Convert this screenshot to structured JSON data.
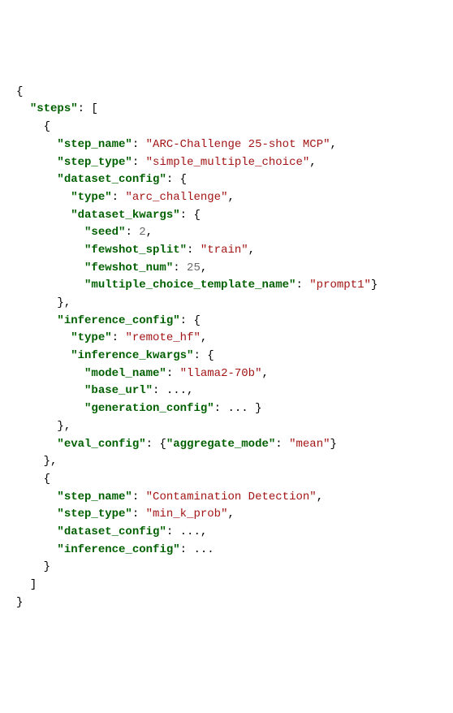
{
  "code": {
    "lines": [
      {
        "indent": 0,
        "tokens": [
          {
            "t": "p",
            "v": "{"
          }
        ]
      },
      {
        "indent": 1,
        "tokens": [
          {
            "t": "k",
            "v": "\"steps\""
          },
          {
            "t": "p",
            "v": ": ["
          }
        ]
      },
      {
        "indent": 2,
        "tokens": [
          {
            "t": "p",
            "v": "{"
          }
        ]
      },
      {
        "indent": 3,
        "tokens": [
          {
            "t": "k",
            "v": "\"step_name\""
          },
          {
            "t": "p",
            "v": ": "
          },
          {
            "t": "s",
            "v": "\"ARC-Challenge 25-shot MCP\""
          },
          {
            "t": "p",
            "v": ","
          }
        ]
      },
      {
        "indent": 3,
        "tokens": [
          {
            "t": "k",
            "v": "\"step_type\""
          },
          {
            "t": "p",
            "v": ": "
          },
          {
            "t": "s",
            "v": "\"simple_multiple_choice\""
          },
          {
            "t": "p",
            "v": ","
          }
        ]
      },
      {
        "indent": 3,
        "tokens": [
          {
            "t": "k",
            "v": "\"dataset_config\""
          },
          {
            "t": "p",
            "v": ": {"
          }
        ]
      },
      {
        "indent": 4,
        "tokens": [
          {
            "t": "k",
            "v": "\"type\""
          },
          {
            "t": "p",
            "v": ": "
          },
          {
            "t": "s",
            "v": "\"arc_challenge\""
          },
          {
            "t": "p",
            "v": ","
          }
        ]
      },
      {
        "indent": 4,
        "tokens": [
          {
            "t": "k",
            "v": "\"dataset_kwargs\""
          },
          {
            "t": "p",
            "v": ": {"
          }
        ]
      },
      {
        "indent": 5,
        "tokens": [
          {
            "t": "k",
            "v": "\"seed\""
          },
          {
            "t": "p",
            "v": ": "
          },
          {
            "t": "n",
            "v": "2"
          },
          {
            "t": "p",
            "v": ","
          }
        ]
      },
      {
        "indent": 5,
        "tokens": [
          {
            "t": "k",
            "v": "\"fewshot_split\""
          },
          {
            "t": "p",
            "v": ": "
          },
          {
            "t": "s",
            "v": "\"train\""
          },
          {
            "t": "p",
            "v": ","
          }
        ]
      },
      {
        "indent": 5,
        "tokens": [
          {
            "t": "k",
            "v": "\"fewshot_num\""
          },
          {
            "t": "p",
            "v": ": "
          },
          {
            "t": "n",
            "v": "25"
          },
          {
            "t": "p",
            "v": ","
          }
        ]
      },
      {
        "indent": 5,
        "tokens": [
          {
            "t": "k",
            "v": "\"multiple_choice_template_name\""
          },
          {
            "t": "p",
            "v": ": "
          },
          {
            "t": "s",
            "v": "\"prompt1\""
          },
          {
            "t": "p",
            "v": "}"
          }
        ]
      },
      {
        "indent": 3,
        "tokens": [
          {
            "t": "p",
            "v": "},"
          }
        ]
      },
      {
        "indent": 3,
        "tokens": [
          {
            "t": "k",
            "v": "\"inference_config\""
          },
          {
            "t": "p",
            "v": ": {"
          }
        ]
      },
      {
        "indent": 4,
        "tokens": [
          {
            "t": "k",
            "v": "\"type\""
          },
          {
            "t": "p",
            "v": ": "
          },
          {
            "t": "s",
            "v": "\"remote_hf\""
          },
          {
            "t": "p",
            "v": ","
          }
        ]
      },
      {
        "indent": 4,
        "tokens": [
          {
            "t": "k",
            "v": "\"inference_kwargs\""
          },
          {
            "t": "p",
            "v": ": {"
          }
        ]
      },
      {
        "indent": 5,
        "tokens": [
          {
            "t": "k",
            "v": "\"model_name\""
          },
          {
            "t": "p",
            "v": ": "
          },
          {
            "t": "s",
            "v": "\"llama2-70b\""
          },
          {
            "t": "p",
            "v": ","
          }
        ]
      },
      {
        "indent": 5,
        "tokens": [
          {
            "t": "k",
            "v": "\"base_url\""
          },
          {
            "t": "p",
            "v": ": ...,"
          }
        ]
      },
      {
        "indent": 5,
        "tokens": [
          {
            "t": "k",
            "v": "\"generation_config\""
          },
          {
            "t": "p",
            "v": ": ... }"
          }
        ]
      },
      {
        "indent": 3,
        "tokens": [
          {
            "t": "p",
            "v": "},"
          }
        ]
      },
      {
        "indent": 3,
        "tokens": [
          {
            "t": "k",
            "v": "\"eval_config\""
          },
          {
            "t": "p",
            "v": ": {"
          },
          {
            "t": "k",
            "v": "\"aggregate_mode\""
          },
          {
            "t": "p",
            "v": ": "
          },
          {
            "t": "s",
            "v": "\"mean\""
          },
          {
            "t": "p",
            "v": "}"
          }
        ]
      },
      {
        "indent": 2,
        "tokens": [
          {
            "t": "p",
            "v": "},"
          }
        ]
      },
      {
        "indent": 2,
        "tokens": [
          {
            "t": "p",
            "v": "{"
          }
        ]
      },
      {
        "indent": 3,
        "tokens": [
          {
            "t": "k",
            "v": "\"step_name\""
          },
          {
            "t": "p",
            "v": ": "
          },
          {
            "t": "s",
            "v": "\"Contamination Detection\""
          },
          {
            "t": "p",
            "v": ","
          }
        ]
      },
      {
        "indent": 3,
        "tokens": [
          {
            "t": "k",
            "v": "\"step_type\""
          },
          {
            "t": "p",
            "v": ": "
          },
          {
            "t": "s",
            "v": "\"min_k_prob\""
          },
          {
            "t": "p",
            "v": ","
          }
        ]
      },
      {
        "indent": 3,
        "tokens": [
          {
            "t": "k",
            "v": "\"dataset_config\""
          },
          {
            "t": "p",
            "v": ": ...,"
          }
        ]
      },
      {
        "indent": 3,
        "tokens": [
          {
            "t": "k",
            "v": "\"inference_config\""
          },
          {
            "t": "p",
            "v": ": ..."
          }
        ]
      },
      {
        "indent": 2,
        "tokens": [
          {
            "t": "p",
            "v": "}"
          }
        ]
      },
      {
        "indent": 1,
        "tokens": [
          {
            "t": "p",
            "v": "]"
          }
        ]
      },
      {
        "indent": 0,
        "tokens": [
          {
            "t": "p",
            "v": "}"
          }
        ]
      }
    ],
    "indent_unit": "  "
  }
}
